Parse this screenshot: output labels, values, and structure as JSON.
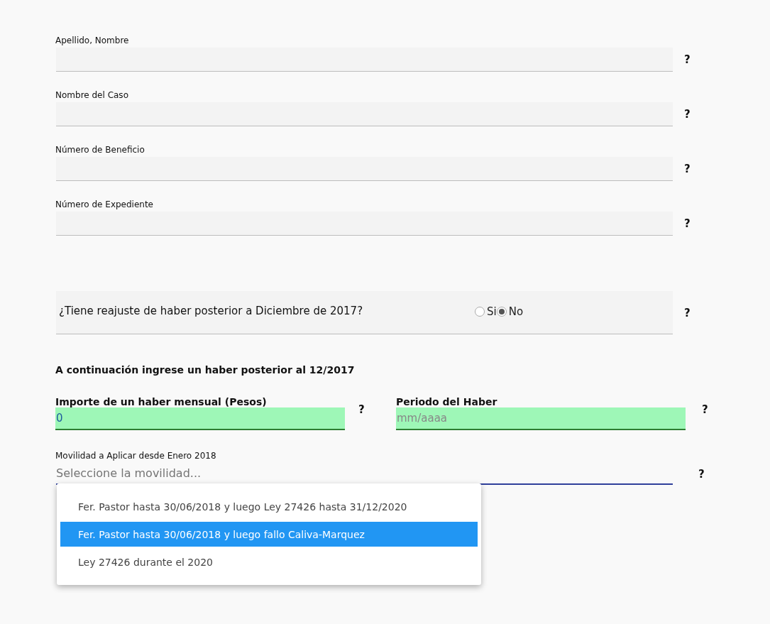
{
  "fields": [
    {
      "label": "Apellido, Nombre",
      "help": "?"
    },
    {
      "label": "Nombre del Caso",
      "help": "?"
    },
    {
      "label": "Número de Beneficio",
      "help": "?"
    },
    {
      "label": "Número de Expediente",
      "help": "?"
    }
  ],
  "question": {
    "text": "¿Tiene reajuste de haber posterior a Diciembre de 2017?",
    "options": [
      {
        "label": "Si",
        "selected": false
      },
      {
        "label": "No",
        "selected": true
      }
    ],
    "help": "?"
  },
  "section_heading": "A continuación ingrese un haber posterior al 12/2017",
  "amount": {
    "label": "Importe de un haber mensual (Pesos)",
    "value": "0",
    "help": "?"
  },
  "period": {
    "label": "Periodo del Haber",
    "placeholder": "mm/aaaa",
    "help": "?"
  },
  "mobility": {
    "label": "Movilidad a Aplicar desde Enero 2018",
    "placeholder": "Seleccione la movilidad...",
    "help": "?",
    "expanded": true,
    "options": [
      {
        "label": "Fer. Pastor hasta 30/06/2018 y luego Ley 27426 hasta 31/12/2020",
        "selected": false
      },
      {
        "label": "Fer. Pastor hasta 30/06/2018 y luego fallo Caliva-Marquez",
        "selected": true
      },
      {
        "label": "Ley 27426 durante el 2020",
        "selected": false
      }
    ]
  }
}
